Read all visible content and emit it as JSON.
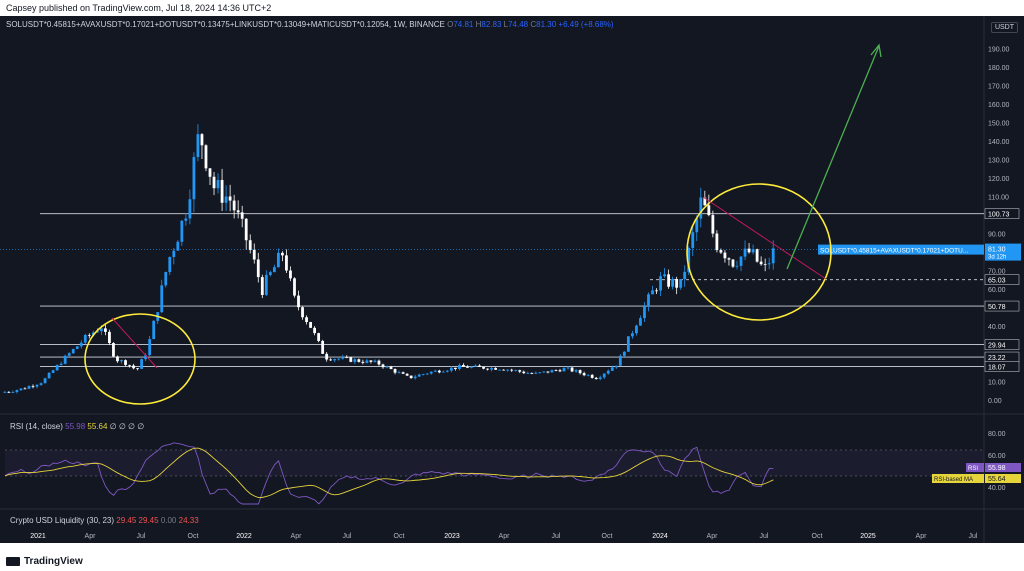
{
  "header": {
    "published": "Capsey published on TradingView.com, Jul 18, 2024 14:36 UTC+2"
  },
  "legend": {
    "symbol": "SOLUSDT*0.45815+AVAXUSDT*0.17021+DOTUSDT*0.13475+LINKUSDT*0.13049+MATICUSDT*0.12054, 1W, BINANCE",
    "o_label": "O",
    "o": "74.81",
    "h_label": "H",
    "h": "82.83",
    "l_label": "L",
    "l": "74.48",
    "c_label": "C",
    "c": "81.30",
    "change": "+6.49 (+8.68%)"
  },
  "currency_button": "USDT",
  "price_axis": {
    "ticks": [
      "190.00",
      "180.00",
      "170.00",
      "160.00",
      "150.00",
      "140.00",
      "130.00",
      "120.00",
      "110.00",
      "100.00",
      "90.00",
      "80.00",
      "70.00",
      "60.00",
      "50.00",
      "40.00",
      "30.00",
      "20.00",
      "10.00",
      "0.00"
    ],
    "levels": [
      {
        "value": 100.73,
        "label": "100.73"
      },
      {
        "value": 65.03,
        "label": "65.03"
      },
      {
        "value": 50.78,
        "label": "50.78"
      },
      {
        "value": 29.94,
        "label": "29.94"
      },
      {
        "value": 23.22,
        "label": "23.22"
      },
      {
        "value": 18.07,
        "label": "18.07"
      }
    ],
    "current_price": "81.30",
    "countdown": "3d 12h",
    "price_tag": "SOLUSDT*0.45815+AVAXUSDT*0.17021+DOTU..."
  },
  "rsi": {
    "title": "RSI (14, close)",
    "value": "55.98",
    "ma_value": "55.64",
    "empty_marks": "∅ ∅ ∅ ∅",
    "axis": [
      "80.00",
      "60.00",
      "40.00"
    ],
    "tag_rsi_label": "RSI",
    "tag_rsi_value": "55.98",
    "tag_ma_label": "RSI-based MA",
    "tag_ma_value": "55.64"
  },
  "liquidity": {
    "title": "Crypto USD Liquidity (30, 23)",
    "v1": "29.45",
    "v2": "29.45",
    "v3": "0.00",
    "v4": "24.33"
  },
  "time_axis": [
    "2021",
    "Apr",
    "Jul",
    "Oct",
    "2022",
    "Apr",
    "Jul",
    "Oct",
    "2023",
    "Apr",
    "Jul",
    "Oct",
    "2024",
    "Apr",
    "Jul",
    "Oct",
    "2025",
    "Apr",
    "Jul"
  ],
  "footer": {
    "brand": "TradingView"
  },
  "colors": {
    "background": "#131722",
    "bull_candle": "#2196f3",
    "bear_candle": "#ffffff",
    "circle": "#ffeb3b",
    "arrow": "#4caf50",
    "trendline": "#c2185b",
    "rsi_line": "#7e57c2",
    "rsi_ma": "#e6d43b"
  },
  "chart_data": {
    "type": "candlestick",
    "timeframe": "1W",
    "series": [
      {
        "name": "SOLUSDT*0.45815+AVAXUSDT*0.17021+DOTUSDT*0.13475+LINKUSDT*0.13049+MATICUSDT*0.12054",
        "close_path": [
          [
            2020.9,
            4
          ],
          [
            2021.0,
            6
          ],
          [
            2021.1,
            10
          ],
          [
            2021.2,
            22
          ],
          [
            2021.3,
            33
          ],
          [
            2021.38,
            40
          ],
          [
            2021.45,
            22
          ],
          [
            2021.5,
            20
          ],
          [
            2021.55,
            16
          ],
          [
            2021.6,
            27
          ],
          [
            2021.65,
            50
          ],
          [
            2021.7,
            75
          ],
          [
            2021.78,
            100
          ],
          [
            2021.85,
            145
          ],
          [
            2021.92,
            115
          ],
          [
            2022.0,
            108
          ],
          [
            2022.08,
            85
          ],
          [
            2022.15,
            60
          ],
          [
            2022.25,
            80
          ],
          [
            2022.3,
            55
          ],
          [
            2022.38,
            40
          ],
          [
            2022.45,
            23
          ],
          [
            2022.55,
            22
          ],
          [
            2022.7,
            20
          ],
          [
            2022.85,
            12
          ],
          [
            2022.95,
            15
          ],
          [
            2023.1,
            18
          ],
          [
            2023.3,
            17
          ],
          [
            2023.45,
            14
          ],
          [
            2023.6,
            17
          ],
          [
            2023.75,
            12
          ],
          [
            2023.85,
            20
          ],
          [
            2023.95,
            45
          ],
          [
            2024.05,
            65
          ],
          [
            2024.15,
            62
          ],
          [
            2024.25,
            108
          ],
          [
            2024.32,
            85
          ],
          [
            2024.4,
            75
          ],
          [
            2024.48,
            80
          ],
          [
            2024.55,
            70
          ],
          [
            2024.6,
            81.3
          ]
        ]
      }
    ],
    "ylim": [
      0,
      195
    ],
    "xlim": [
      "2020-12",
      "2025-08"
    ]
  }
}
